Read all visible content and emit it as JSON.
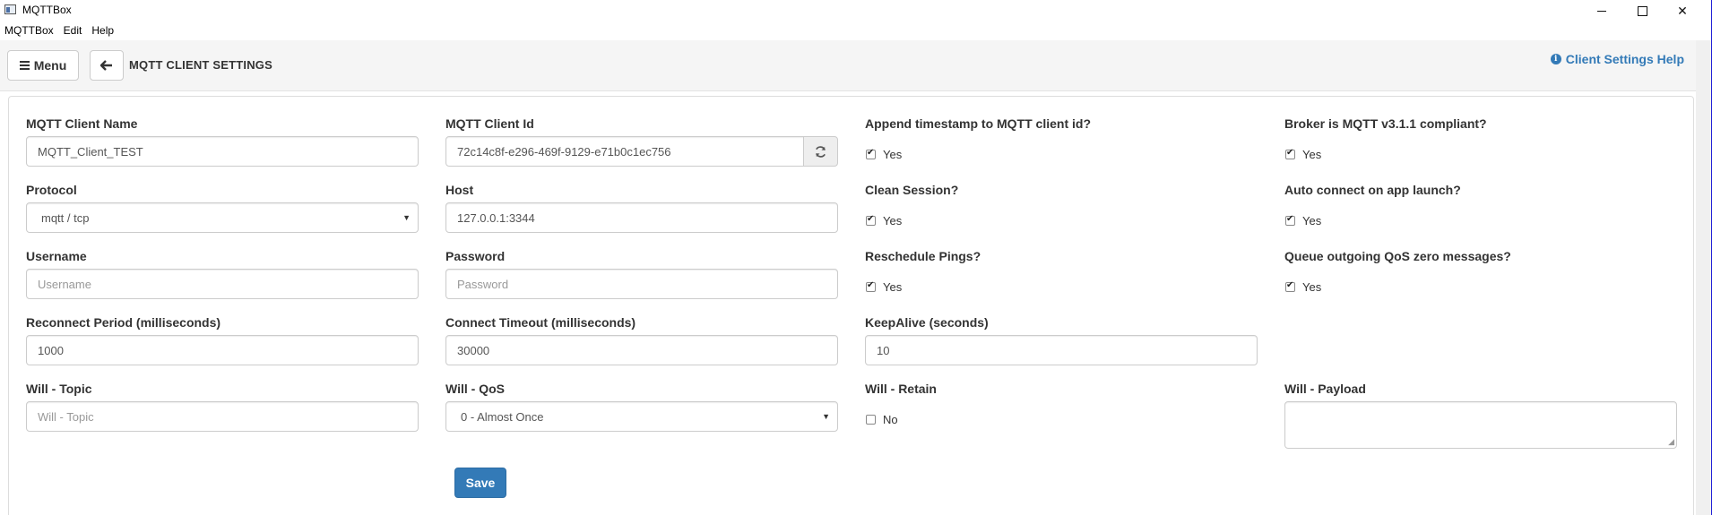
{
  "window": {
    "title": "MQTTBox"
  },
  "menubar": {
    "items": [
      "MQTTBox",
      "Edit",
      "Help"
    ]
  },
  "header": {
    "menu_label": "Menu",
    "back_icon": "arrow-left-icon",
    "title": "MQTT CLIENT SETTINGS",
    "help_label": "Client Settings Help"
  },
  "form": {
    "client_name": {
      "label": "MQTT Client Name",
      "value": "MQTT_Client_TEST",
      "placeholder": ""
    },
    "client_id": {
      "label": "MQTT Client Id",
      "value": "72c14c8f-e296-469f-9129-e71b0c1ec756",
      "refresh_icon": "refresh-icon"
    },
    "append_timestamp": {
      "label": "Append timestamp to MQTT client id?",
      "option": "Yes",
      "checked": true
    },
    "broker_compliant": {
      "label": "Broker is MQTT v3.1.1 compliant?",
      "option": "Yes",
      "checked": true
    },
    "protocol": {
      "label": "Protocol",
      "value": "mqtt / tcp"
    },
    "host": {
      "label": "Host",
      "value": "127.0.0.1:3344"
    },
    "clean_session": {
      "label": "Clean Session?",
      "option": "Yes",
      "checked": true
    },
    "auto_connect": {
      "label": "Auto connect on app launch?",
      "option": "Yes",
      "checked": true
    },
    "username": {
      "label": "Username",
      "placeholder": "Username"
    },
    "password": {
      "label": "Password",
      "placeholder": "Password"
    },
    "reschedule_pings": {
      "label": "Reschedule Pings?",
      "option": "Yes",
      "checked": true
    },
    "queue_qos_zero": {
      "label": "Queue outgoing QoS zero messages?",
      "option": "Yes",
      "checked": true
    },
    "reconnect_period": {
      "label": "Reconnect Period (milliseconds)",
      "value": "1000"
    },
    "connect_timeout": {
      "label": "Connect Timeout (milliseconds)",
      "value": "30000"
    },
    "keepalive": {
      "label": "KeepAlive (seconds)",
      "value": "10"
    },
    "will_topic": {
      "label": "Will - Topic",
      "placeholder": "Will - Topic"
    },
    "will_qos": {
      "label": "Will - QoS",
      "value": "0 - Almost Once"
    },
    "will_retain": {
      "label": "Will - Retain",
      "option": "No",
      "checked": false
    },
    "will_payload": {
      "label": "Will - Payload",
      "value": ""
    },
    "save_label": "Save"
  }
}
